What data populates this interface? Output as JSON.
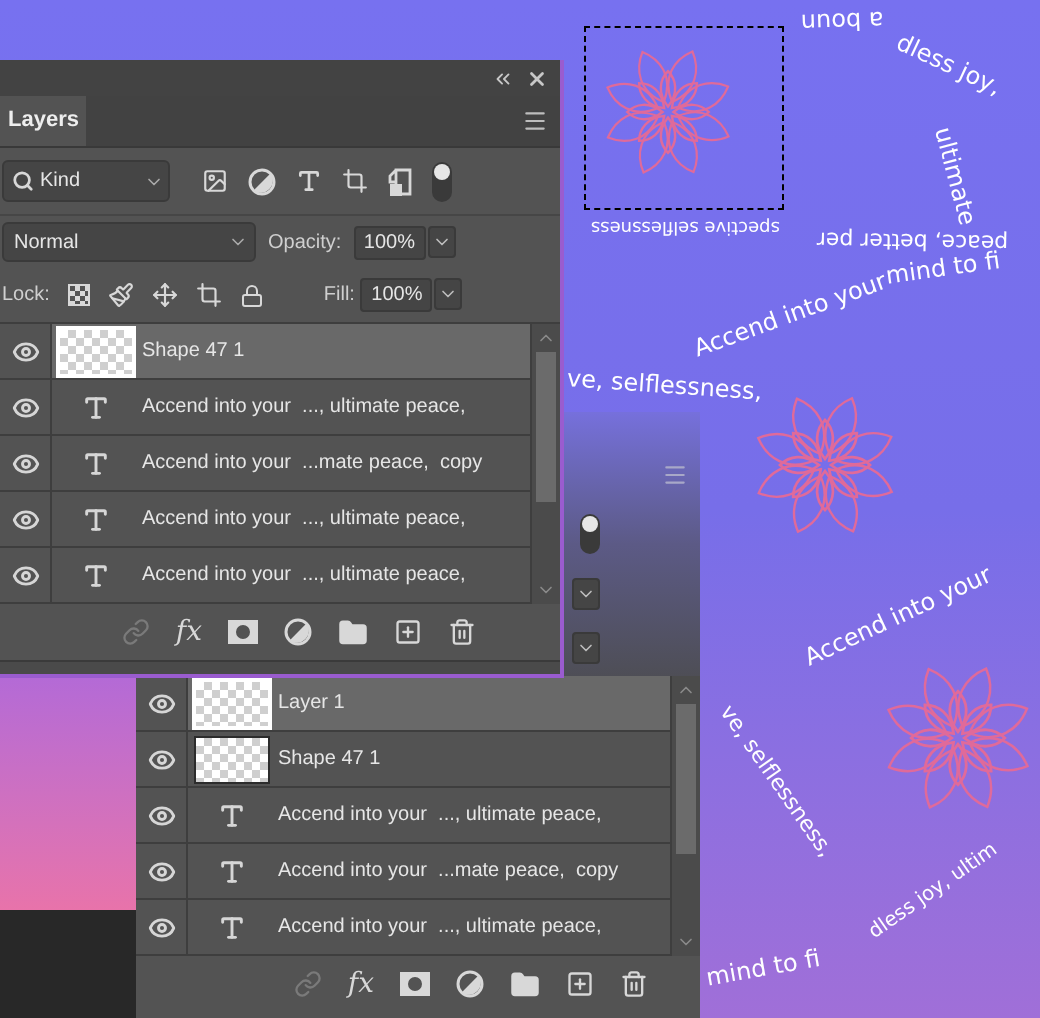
{
  "front_panel": {
    "tabs": [
      {
        "label": "Layers",
        "selected": true
      }
    ],
    "filter": {
      "value": "Kind"
    },
    "blend_mode": {
      "value": "Normal"
    },
    "opacity": {
      "label": "Opacity:",
      "value": "100%"
    },
    "lock": {
      "label": "Lock:"
    },
    "fill": {
      "label": "Fill:",
      "value": "100%"
    },
    "layers": [
      {
        "name": "Shape 47 1",
        "kind": "image",
        "visible": true,
        "selected": true
      },
      {
        "name": "Accend into your  ..., ultimate peace,",
        "kind": "text",
        "visible": true,
        "selected": false
      },
      {
        "name": "Accend into your  ...mate peace,  copy",
        "kind": "text",
        "visible": true,
        "selected": false
      },
      {
        "name": "Accend into your  ..., ultimate peace,",
        "kind": "text",
        "visible": true,
        "selected": false
      },
      {
        "name": "Accend into your  ..., ultimate peace,",
        "kind": "text",
        "visible": true,
        "selected": false
      }
    ],
    "footer": {
      "fx": "fx"
    }
  },
  "back_panel": {
    "layers": [
      {
        "name": "Layer 1",
        "kind": "image",
        "visible": true,
        "selected": true
      },
      {
        "name": "Shape 47 1",
        "kind": "image",
        "visible": true,
        "selected": false
      },
      {
        "name": "Accend into your  ..., ultimate peace,",
        "kind": "text",
        "visible": true,
        "selected": false
      },
      {
        "name": "Accend into your  ...mate peace,  copy",
        "kind": "text",
        "visible": true,
        "selected": false
      },
      {
        "name": "Accend into your  ..., ultimate peace,",
        "kind": "text",
        "visible": true,
        "selected": false
      }
    ],
    "footer": {
      "fx": "fx"
    }
  },
  "canvas": {
    "curved_texts": [
      "a boun",
      "dless joy,",
      "ultimate",
      "peace, better per",
      "spective selflessness",
      "Accend into your",
      "mind to fi",
      "ve, selflessness,",
      "Accend into your",
      "ve, selflessness,",
      "dless joy, ultim",
      "mind to fi"
    ]
  }
}
